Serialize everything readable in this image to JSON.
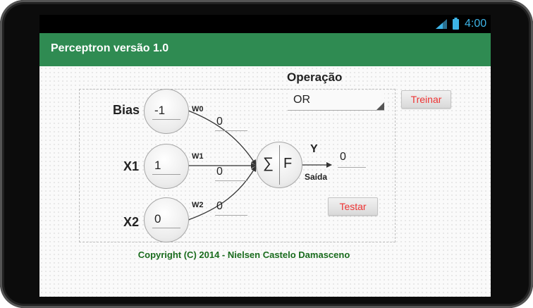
{
  "status_bar": {
    "time": "4:00"
  },
  "app": {
    "title": "Perceptron versão 1.0"
  },
  "operation": {
    "label": "Operação",
    "selected": "OR"
  },
  "buttons": {
    "train": "Treinar",
    "test": "Testar"
  },
  "inputs": [
    {
      "label": "Bias",
      "value": "-1",
      "weight_label": "W0",
      "weight_value": "0"
    },
    {
      "label": "X1",
      "value": "1",
      "weight_label": "W1",
      "weight_value": "0"
    },
    {
      "label": "X2",
      "value": "0",
      "weight_label": "W2",
      "weight_value": "0"
    }
  ],
  "node": {
    "sum_symbol": "∑",
    "function_symbol": "F"
  },
  "output": {
    "label": "Y",
    "sublabel": "Saída",
    "value": "0"
  },
  "footer": {
    "copyright": "Copyright (C) 2014 - Nielsen Castelo Damasceno"
  },
  "colors": {
    "app_bar": "#2f8b52",
    "button_text": "#e33333",
    "copyright": "#196b1d",
    "status_icons": "#3db3e6"
  }
}
